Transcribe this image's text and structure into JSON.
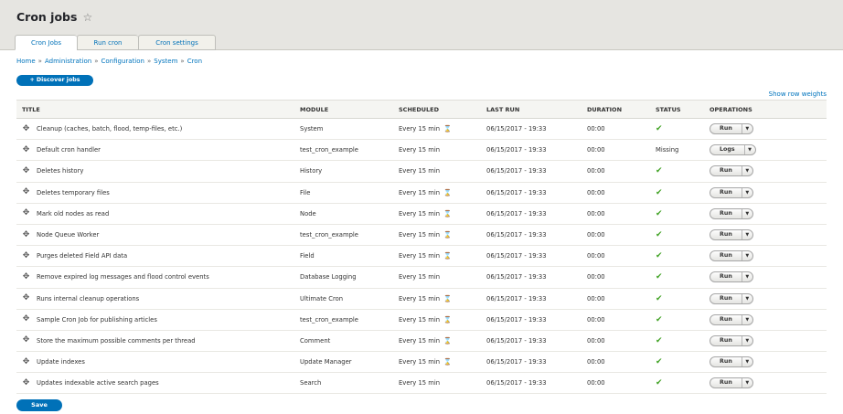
{
  "page": {
    "title": "Cron jobs",
    "tabs": [
      {
        "label": "Cron Jobs",
        "active": true
      },
      {
        "label": "Run cron",
        "active": false
      },
      {
        "label": "Cron settings",
        "active": false
      }
    ],
    "breadcrumb": [
      "Home",
      "Administration",
      "Configuration",
      "System",
      "Cron"
    ],
    "breadcrumb_separator": "»",
    "discover_label": "+ Discover jobs",
    "show_weights_label": "Show row weights",
    "save_label": "Save"
  },
  "table": {
    "headers": [
      "TITLE",
      "MODULE",
      "SCHEDULED",
      "LAST RUN",
      "DURATION",
      "STATUS",
      "OPERATIONS"
    ],
    "rows": [
      {
        "title": "Cleanup (caches, batch, flood, temp-files, etc.)",
        "module": "System",
        "scheduled": "Every 15 min",
        "hourglass": true,
        "last_run": "06/15/2017 - 19:33",
        "duration": "00:00",
        "status": "ok",
        "status_text": "",
        "op": "Run"
      },
      {
        "title": "Default cron handler",
        "module": "test_cron_example",
        "scheduled": "Every 15 min",
        "hourglass": false,
        "last_run": "06/15/2017 - 19:33",
        "duration": "00:00",
        "status": "text",
        "status_text": "Missing",
        "op": "Logs"
      },
      {
        "title": "Deletes history",
        "module": "History",
        "scheduled": "Every 15 min",
        "hourglass": false,
        "last_run": "06/15/2017 - 19:33",
        "duration": "00:00",
        "status": "ok",
        "status_text": "",
        "op": "Run"
      },
      {
        "title": "Deletes temporary files",
        "module": "File",
        "scheduled": "Every 15 min",
        "hourglass": true,
        "last_run": "06/15/2017 - 19:33",
        "duration": "00:00",
        "status": "ok",
        "status_text": "",
        "op": "Run"
      },
      {
        "title": "Mark old nodes as read",
        "module": "Node",
        "scheduled": "Every 15 min",
        "hourglass": true,
        "last_run": "06/15/2017 - 19:33",
        "duration": "00:00",
        "status": "ok",
        "status_text": "",
        "op": "Run"
      },
      {
        "title": "Node Queue Worker",
        "module": "test_cron_example",
        "scheduled": "Every 15 min",
        "hourglass": true,
        "last_run": "06/15/2017 - 19:33",
        "duration": "00:00",
        "status": "ok",
        "status_text": "",
        "op": "Run"
      },
      {
        "title": "Purges deleted Field API data",
        "module": "Field",
        "scheduled": "Every 15 min",
        "hourglass": true,
        "last_run": "06/15/2017 - 19:33",
        "duration": "00:00",
        "status": "ok",
        "status_text": "",
        "op": "Run"
      },
      {
        "title": "Remove expired log messages and flood control events",
        "module": "Database Logging",
        "scheduled": "Every 15 min",
        "hourglass": false,
        "last_run": "06/15/2017 - 19:33",
        "duration": "00:00",
        "status": "ok",
        "status_text": "",
        "op": "Run"
      },
      {
        "title": "Runs internal cleanup operations",
        "module": "Ultimate Cron",
        "scheduled": "Every 15 min",
        "hourglass": true,
        "last_run": "06/15/2017 - 19:33",
        "duration": "00:00",
        "status": "ok",
        "status_text": "",
        "op": "Run"
      },
      {
        "title": "Sample Cron Job for publishing articles",
        "module": "test_cron_example",
        "scheduled": "Every 15 min",
        "hourglass": true,
        "last_run": "06/15/2017 - 19:33",
        "duration": "00:00",
        "status": "ok",
        "status_text": "",
        "op": "Run"
      },
      {
        "title": "Store the maximum possible comments per thread",
        "module": "Comment",
        "scheduled": "Every 15 min",
        "hourglass": true,
        "last_run": "06/15/2017 - 19:33",
        "duration": "00:00",
        "status": "ok",
        "status_text": "",
        "op": "Run"
      },
      {
        "title": "Update indexes",
        "module": "Update Manager",
        "scheduled": "Every 15 min",
        "hourglass": true,
        "last_run": "06/15/2017 - 19:33",
        "duration": "00:00",
        "status": "ok",
        "status_text": "",
        "op": "Run"
      },
      {
        "title": "Updates indexable active search pages",
        "module": "Search",
        "scheduled": "Every 15 min",
        "hourglass": false,
        "last_run": "06/15/2017 - 19:33",
        "duration": "00:00",
        "status": "ok",
        "status_text": "",
        "op": "Run"
      }
    ]
  },
  "icons": {
    "star": "star-outline-icon",
    "drag": "move-arrows-icon",
    "hourglass": "hourglass-icon",
    "check": "check-icon",
    "dropdown": "chevron-down-icon"
  },
  "colors": {
    "accent": "#0071b8",
    "link": "#0074bd",
    "success": "#42a326",
    "header_bg": "#e6e5e1"
  }
}
